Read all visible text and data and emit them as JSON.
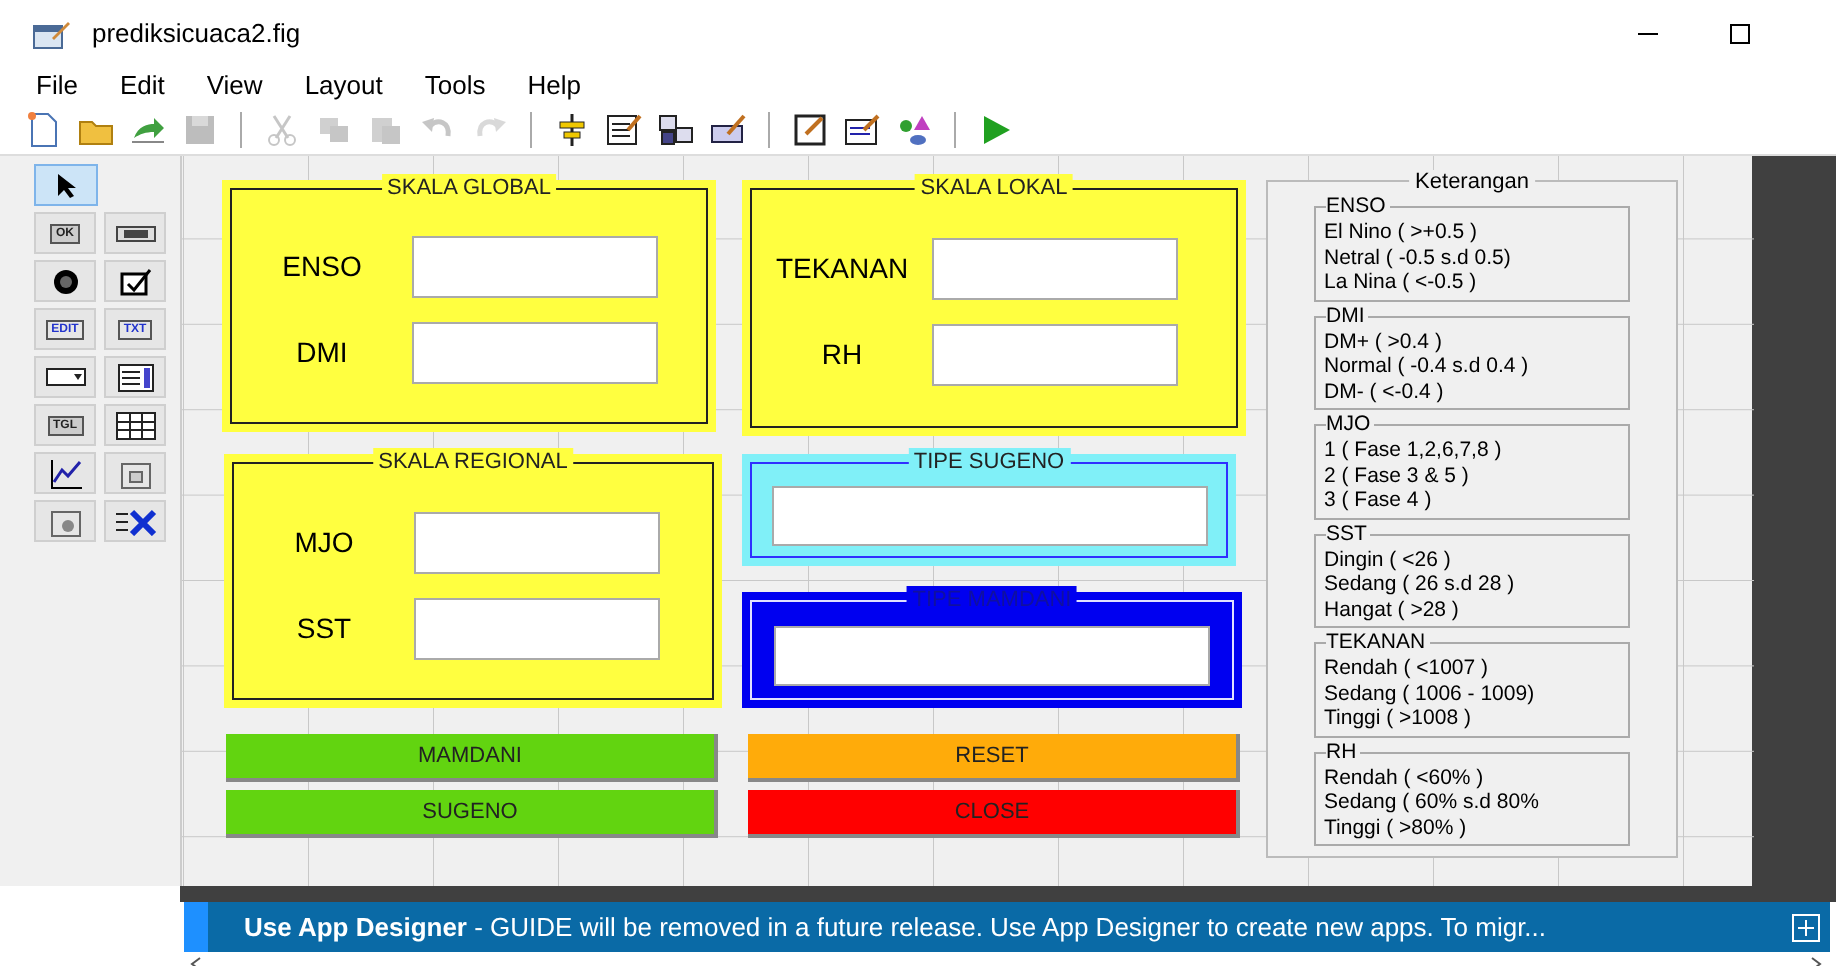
{
  "window": {
    "title": "prediksicuaca2.fig"
  },
  "menu": [
    {
      "label": "File"
    },
    {
      "label": "Edit"
    },
    {
      "label": "View"
    },
    {
      "label": "Layout"
    },
    {
      "label": "Tools"
    },
    {
      "label": "Help"
    }
  ],
  "toolbar": [
    {
      "kind": "new",
      "disabled": false
    },
    {
      "kind": "open",
      "disabled": false
    },
    {
      "kind": "export",
      "disabled": false
    },
    {
      "kind": "save",
      "disabled": true
    },
    {
      "kind": "sep"
    },
    {
      "kind": "cut",
      "disabled": true
    },
    {
      "kind": "copy",
      "disabled": true
    },
    {
      "kind": "paste",
      "disabled": true
    },
    {
      "kind": "undo",
      "disabled": true
    },
    {
      "kind": "redo",
      "disabled": true
    },
    {
      "kind": "sep"
    },
    {
      "kind": "align",
      "disabled": false
    },
    {
      "kind": "menu",
      "disabled": false
    },
    {
      "kind": "taborder",
      "disabled": false
    },
    {
      "kind": "toolbar",
      "disabled": false
    },
    {
      "kind": "sep"
    },
    {
      "kind": "editor",
      "disabled": false
    },
    {
      "kind": "inspector",
      "disabled": false
    },
    {
      "kind": "browser",
      "disabled": false
    },
    {
      "kind": "sep"
    },
    {
      "kind": "run",
      "disabled": false
    }
  ],
  "palette": [
    {
      "kind": "select",
      "selected": true
    },
    {
      "kind": "push",
      "label": "OK",
      "selected": false
    },
    {
      "kind": "slider",
      "selected": false
    },
    {
      "kind": "radio",
      "selected": false
    },
    {
      "kind": "check",
      "selected": false
    },
    {
      "kind": "edit",
      "label": "EDIT",
      "selected": false
    },
    {
      "kind": "text",
      "label": "TXT",
      "selected": false
    },
    {
      "kind": "popup",
      "selected": false
    },
    {
      "kind": "listbox",
      "selected": false
    },
    {
      "kind": "toggle",
      "label": "TGL",
      "selected": false
    },
    {
      "kind": "table",
      "selected": false
    },
    {
      "kind": "axes",
      "selected": false
    },
    {
      "kind": "panel",
      "selected": false
    },
    {
      "kind": "group",
      "selected": false
    },
    {
      "kind": "activex",
      "selected": false
    }
  ],
  "panels": [
    {
      "title": "SKALA GLOBAL",
      "color": "#ffff40",
      "fields": [
        {
          "label": "ENSO"
        },
        {
          "label": "DMI"
        }
      ]
    },
    {
      "title": "SKALA LOKAL",
      "color": "#ffff40",
      "fields": [
        {
          "label": "TEKANAN"
        },
        {
          "label": "RH"
        }
      ]
    },
    {
      "title": "SKALA REGIONAL",
      "color": "#ffff40",
      "fields": [
        {
          "label": "MJO"
        },
        {
          "label": "SST"
        }
      ]
    },
    {
      "title": "TIPE SUGENO",
      "color": "#80f0f8",
      "fields": [
        {
          "kind": "output"
        }
      ]
    },
    {
      "title": "TIPE MAMDANI",
      "color": "#0000f0",
      "fields": [
        {
          "kind": "output"
        }
      ]
    }
  ],
  "buttons": [
    {
      "label": "MAMDANI",
      "color": "#62d410"
    },
    {
      "label": "RESET",
      "color": "#ffab0a"
    },
    {
      "label": "SUGENO",
      "color": "#62d410"
    },
    {
      "label": "CLOSE",
      "color": "#ff0000"
    }
  ],
  "legend": {
    "title": "Keterangan",
    "groups": [
      {
        "title": "ENSO",
        "lines": [
          "El Nino ( >+0.5 )",
          "Netral ( -0.5 s.d 0.5)",
          "La Nina ( <-0.5 )"
        ]
      },
      {
        "title": "DMI",
        "lines": [
          "DM+ ( >0.4 )",
          "Normal ( -0.4 s.d 0.4 )",
          "DM- ( <-0.4 )"
        ]
      },
      {
        "title": "MJO",
        "lines": [
          "1 ( Fase 1,2,6,7,8 )",
          "2 ( Fase 3 & 5 )",
          "3 ( Fase 4 )"
        ]
      },
      {
        "title": "SST",
        "lines": [
          "Dingin ( <26 )",
          "Sedang ( 26 s.d 28 )",
          "Hangat ( >28 )"
        ]
      },
      {
        "title": "TEKANAN",
        "lines": [
          "Rendah ( <1007 )",
          "Sedang ( 1006 - 1009)",
          "Tinggi ( >1008 )"
        ]
      },
      {
        "title": "RH",
        "lines": [
          "Rendah ( <60% )",
          "Sedang ( 60% s.d 80%",
          "Tinggi ( >80% )"
        ]
      }
    ]
  },
  "banner": {
    "text": "**Use App Designer** - GUIDE will be removed in a future release. Use App Designer to create new apps. To migr..."
  }
}
